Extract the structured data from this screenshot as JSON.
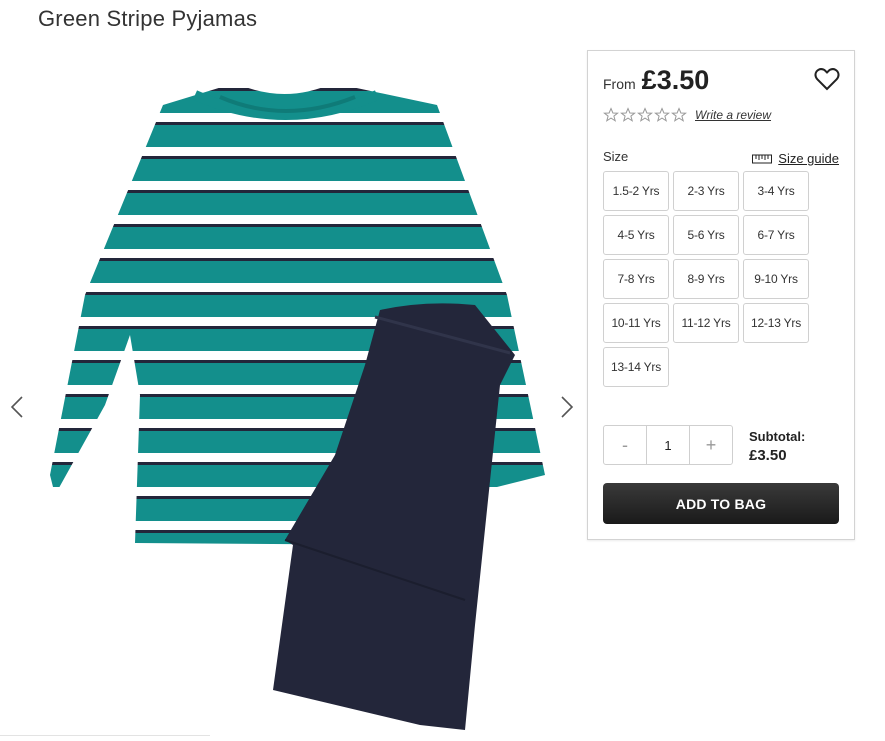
{
  "product": {
    "title": "Green Stripe Pyjamas"
  },
  "gallery": {
    "prev_icon": "chevron-left-icon",
    "next_icon": "chevron-right-icon",
    "image_subject": "pyjamas"
  },
  "purchase": {
    "from_label": "From",
    "price": "£3.50",
    "review_link": "Write a review",
    "size_label": "Size",
    "size_guide_label": "Size guide",
    "sizes": [
      "1.5-2 Yrs",
      "2-3 Yrs",
      "3-4 Yrs",
      "4-5 Yrs",
      "5-6 Yrs",
      "6-7 Yrs",
      "7-8 Yrs",
      "8-9 Yrs",
      "9-10 Yrs",
      "10-11 Yrs",
      "11-12 Yrs",
      "12-13 Yrs",
      "13-14 Yrs"
    ],
    "quantity": {
      "minus_label": "-",
      "value": "1",
      "plus_label": "+"
    },
    "subtotal_label": "Subtotal:",
    "subtotal_value": "£3.50",
    "add_to_bag_label": "ADD TO BAG"
  },
  "colors": {
    "teal": "#138f8c",
    "navy": "#23263a",
    "button_dark": "#222222"
  }
}
